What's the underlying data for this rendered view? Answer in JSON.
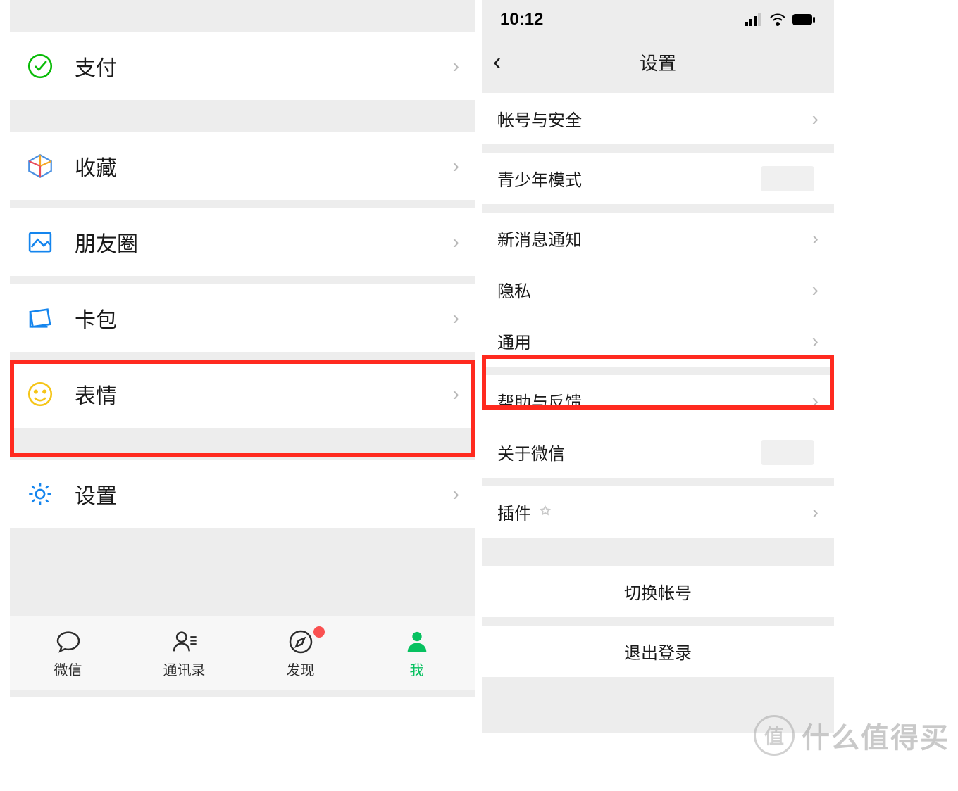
{
  "left": {
    "items": {
      "pay": {
        "label": "支付",
        "icon": "pay-icon"
      },
      "fav": {
        "label": "收藏",
        "icon": "cube-icon"
      },
      "moments": {
        "label": "朋友圈",
        "icon": "moments-icon"
      },
      "cards": {
        "label": "卡包",
        "icon": "card-icon"
      },
      "stickers": {
        "label": "表情",
        "icon": "smile-icon"
      },
      "settings": {
        "label": "设置",
        "icon": "gear-icon"
      }
    },
    "tabs": {
      "chat": "微信",
      "contacts": "通讯录",
      "discover": "发现",
      "me": "我"
    }
  },
  "right": {
    "status_time": "10:12",
    "title": "设置",
    "items": {
      "account": "帐号与安全",
      "teen": "青少年模式",
      "notif": "新消息通知",
      "privacy": "隐私",
      "general": "通用",
      "help": "帮助与反馈",
      "about": "关于微信",
      "plugins": "插件",
      "switch": "切换帐号",
      "logout": "退出登录"
    }
  },
  "watermark": {
    "badge": "值",
    "text": "什么值得买"
  }
}
